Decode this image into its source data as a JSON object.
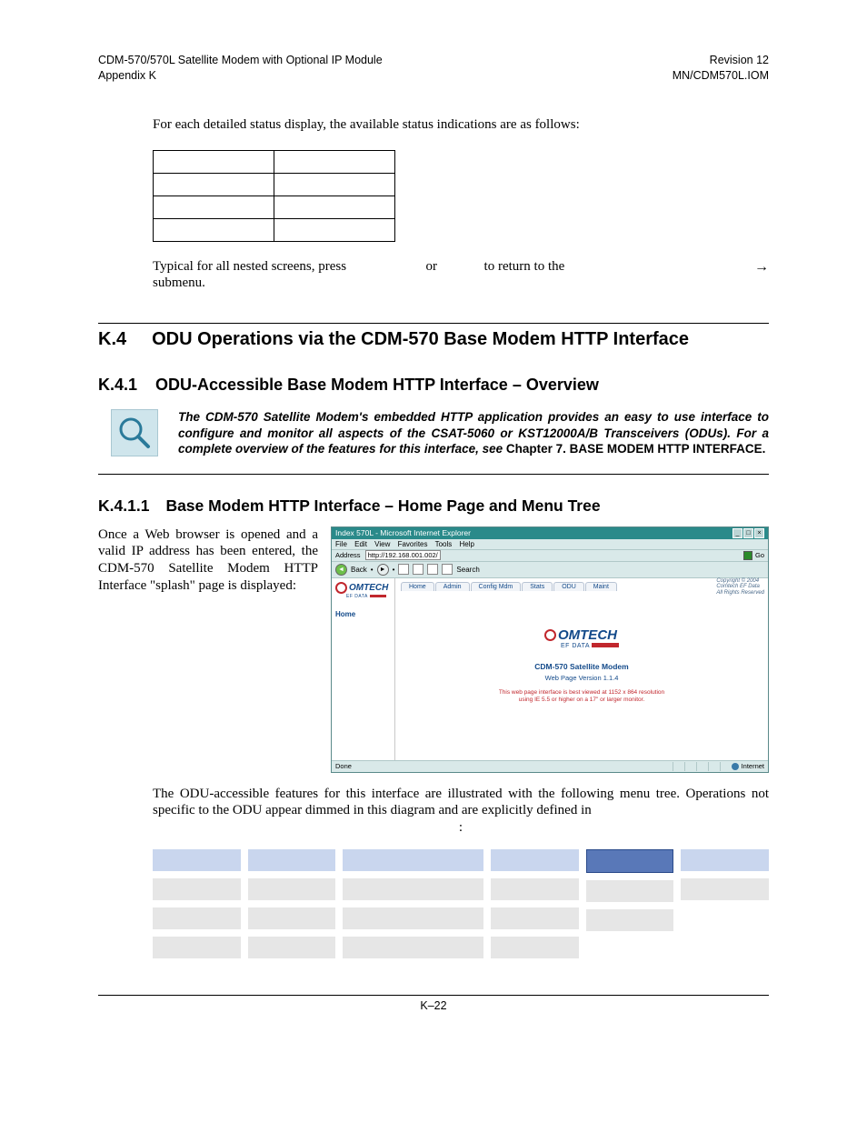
{
  "header": {
    "left_line1": "CDM-570/570L Satellite Modem with Optional IP Module",
    "left_line2": "Appendix K",
    "right_line1": "Revision 12",
    "right_line2": "MN/CDM570L.IOM"
  },
  "intro_para": "For each detailed status display, the available status indications are as follows:",
  "typical_line_a": "Typical for all nested screens, press ",
  "typical_or": "or",
  "typical_line_b": " to return to the ",
  "typical_arrow": "→",
  "typical_line_c": "submenu.",
  "sec_k4": {
    "num": "K.4",
    "title": "ODU Operations via the CDM-570 Base Modem HTTP Interface"
  },
  "sec_k41": {
    "num": "K.4.1",
    "title": "ODU-Accessible Base Modem HTTP Interface – Overview"
  },
  "callout": {
    "italic": "The CDM-570 Satellite Modem's embedded HTTP application provides an easy to use interface to configure and monitor all aspects of the CSAT-5060 or KST12000A/B Transceivers (ODUs). For a complete overview of the features for this interface, see ",
    "bold_nonitalic": "Chapter 7. BASE MODEM HTTP INTERFACE."
  },
  "sec_k411": {
    "num": "K.4.1.1",
    "title": "Base Modem HTTP Interface – Home Page and Menu Tree"
  },
  "splash_para": "Once a Web browser is opened and a valid IP address has been entered, the CDM-570 Satellite Modem HTTP Interface \"splash\" page is displayed:",
  "ie": {
    "title": "Index 570L - Microsoft Internet Explorer",
    "menu": [
      "File",
      "Edit",
      "View",
      "Favorites",
      "Tools",
      "Help"
    ],
    "addr_label": "Address",
    "addr_value": "http://192.168.001.002/",
    "go": "Go",
    "back": "Back",
    "search": "Search",
    "logo_main": "OMTECH",
    "logo_sub": "EF DATA",
    "nav_home": "Home",
    "tabs": [
      "Home",
      "Admin",
      "Config Mdm",
      "Stats",
      "ODU",
      "Maint"
    ],
    "copy1": "Copyright © 2004",
    "copy2": "Comtech EF Data",
    "copy3": "All Rights Reserved",
    "center1": "CDM-570 Satellite Modem",
    "center2": "Web Page Version 1.1.4",
    "center3a": "This web page interface is best viewed at 1152 x 864 resolution",
    "center3b": "using IE 5.5 or higher on a 17\" or larger monitor.",
    "status_done": "Done",
    "status_inet": "Internet"
  },
  "after_splash_a": "The ODU-accessible features for this interface are illustrated with the following menu tree. Operations not specific to the ODU appear dimmed in this diagram and are explicitly defined in",
  "after_splash_colon": ":",
  "footer": "K–22"
}
